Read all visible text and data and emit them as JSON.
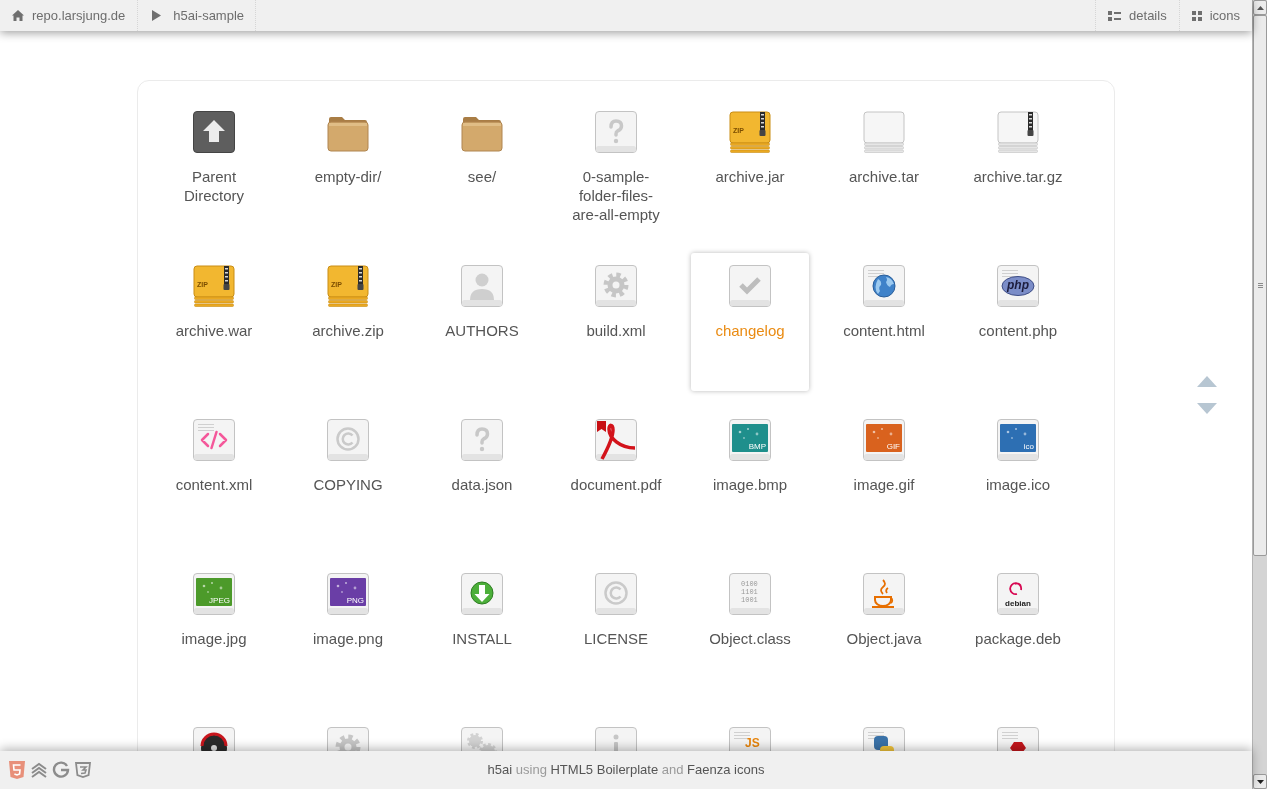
{
  "breadcrumbs": [
    {
      "label": "repo.larsjung.de",
      "kind": "home"
    },
    {
      "label": "h5ai-sample",
      "kind": "folder"
    }
  ],
  "view_modes": [
    {
      "label": "details",
      "kind": "list"
    },
    {
      "label": "icons",
      "kind": "grid"
    }
  ],
  "files": [
    {
      "name": "Parent Directory",
      "kind": "parent",
      "selected": false
    },
    {
      "name": "empty-dir/",
      "kind": "folder",
      "selected": false
    },
    {
      "name": "see/",
      "kind": "folder",
      "selected": false
    },
    {
      "name": "0-sample-folder-files-are-all-empty",
      "kind": "unknown",
      "selected": false
    },
    {
      "name": "archive.jar",
      "kind": "zip",
      "badge": "ZIP",
      "selected": false
    },
    {
      "name": "archive.tar",
      "kind": "tar",
      "selected": false
    },
    {
      "name": "archive.tar.gz",
      "kind": "gz",
      "selected": false
    },
    {
      "name": "archive.war",
      "kind": "zip",
      "badge": "ZIP",
      "selected": false
    },
    {
      "name": "archive.zip",
      "kind": "zip",
      "badge": "ZIP",
      "selected": false
    },
    {
      "name": "AUTHORS",
      "kind": "person",
      "selected": false
    },
    {
      "name": "build.xml",
      "kind": "gear",
      "selected": false
    },
    {
      "name": "changelog",
      "kind": "check",
      "selected": true
    },
    {
      "name": "content.html",
      "kind": "html",
      "selected": false
    },
    {
      "name": "content.php",
      "kind": "php",
      "badge": "php",
      "selected": false
    },
    {
      "name": "content.xml",
      "kind": "xml",
      "selected": false
    },
    {
      "name": "COPYING",
      "kind": "copyright",
      "selected": false
    },
    {
      "name": "data.json",
      "kind": "unknown",
      "selected": false
    },
    {
      "name": "document.pdf",
      "kind": "pdf",
      "selected": false
    },
    {
      "name": "image.bmp",
      "kind": "image",
      "badge": "BMP",
      "color": "#1f8f8c",
      "selected": false
    },
    {
      "name": "image.gif",
      "kind": "image",
      "badge": "GIF",
      "color": "#d9621e",
      "selected": false
    },
    {
      "name": "image.ico",
      "kind": "image",
      "badge": "ico",
      "color": "#2d6fb3",
      "selected": false
    },
    {
      "name": "image.jpg",
      "kind": "image",
      "badge": "JPEG",
      "color": "#4c9a2a",
      "selected": false
    },
    {
      "name": "image.png",
      "kind": "image",
      "badge": "PNG",
      "color": "#6a3ea6",
      "selected": false
    },
    {
      "name": "INSTALL",
      "kind": "install",
      "selected": false
    },
    {
      "name": "LICENSE",
      "kind": "copyright",
      "selected": false
    },
    {
      "name": "Object.class",
      "kind": "binary",
      "badge": "0100 1101 1001",
      "selected": false
    },
    {
      "name": "Object.java",
      "kind": "java",
      "selected": false
    },
    {
      "name": "package.deb",
      "kind": "deb",
      "badge": "debian",
      "selected": false
    },
    {
      "kind": "disc",
      "selected": false
    },
    {
      "kind": "gear",
      "selected": false
    },
    {
      "kind": "gears",
      "selected": false
    },
    {
      "kind": "info",
      "selected": false
    },
    {
      "kind": "js",
      "badge": "JS",
      "selected": false
    },
    {
      "kind": "python",
      "selected": false
    },
    {
      "kind": "ruby",
      "selected": false
    }
  ],
  "footer": {
    "credits": [
      {
        "text": "h5ai",
        "link": true
      },
      {
        "text": "using",
        "link": false
      },
      {
        "text": "HTML5 Boilerplate",
        "link": true
      },
      {
        "text": "and",
        "link": false
      },
      {
        "text": "Faenza icons",
        "link": true
      }
    ]
  }
}
